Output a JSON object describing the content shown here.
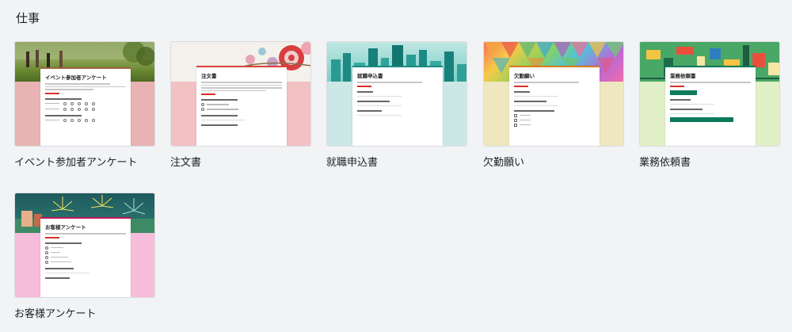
{
  "section": {
    "title": "仕事"
  },
  "templates": [
    {
      "label": "イベント参加者アンケート",
      "form_title": "イベント参加者アンケート",
      "accent": "#a46a44",
      "background": "#e8b3b2"
    },
    {
      "label": "注文書",
      "form_title": "注文書",
      "accent": "#db4437",
      "background": "#f2c1c4"
    },
    {
      "label": "就職申込書",
      "form_title": "就職申込書",
      "accent": "#1a8d86",
      "background": "#cbe8e6"
    },
    {
      "label": "欠勤願い",
      "form_title": "欠勤願い",
      "accent": "#d87f22",
      "background": "#efe7bf"
    },
    {
      "label": "業務依頼書",
      "form_title": "業務依頼書",
      "accent": "#0b7b5b",
      "background": "#e1f0c6"
    },
    {
      "label": "お客様アンケート",
      "form_title": "お客様アンケート",
      "accent": "#c2185b",
      "background": "#f8bcdb"
    }
  ]
}
